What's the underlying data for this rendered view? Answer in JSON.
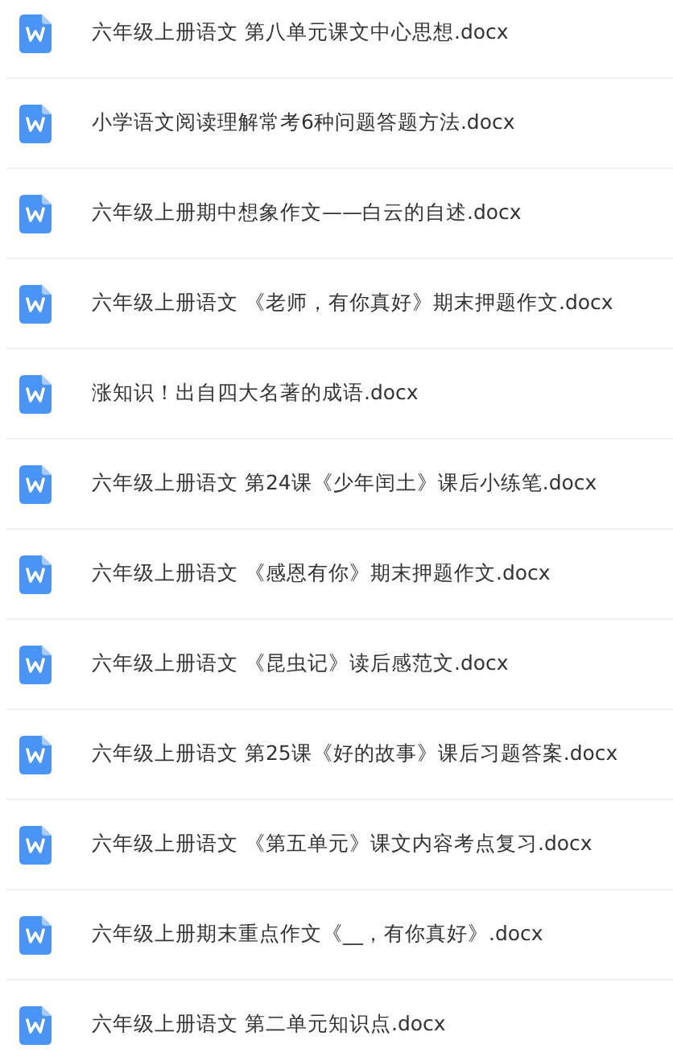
{
  "files": [
    {
      "name": "六年级上册语文 第八单元课文中心思想.docx"
    },
    {
      "name": "小学语文阅读理解常考6种问题答题方法.docx"
    },
    {
      "name": "六年级上册期中想象作文——白云的自述.docx"
    },
    {
      "name": "六年级上册语文 《老师，有你真好》期末押题作文.docx"
    },
    {
      "name": "涨知识！出自四大名著的成语.docx"
    },
    {
      "name": "六年级上册语文 第24课《少年闰土》课后小练笔.docx"
    },
    {
      "name": "六年级上册语文 《感恩有你》期末押题作文.docx"
    },
    {
      "name": "六年级上册语文 《昆虫记》读后感范文.docx"
    },
    {
      "name": "六年级上册语文 第25课《好的故事》课后习题答案.docx"
    },
    {
      "name": "六年级上册语文 《第五单元》课文内容考点复习.docx"
    },
    {
      "name": "六年级上册期末重点作文《__，有你真好》.docx"
    },
    {
      "name": "六年级上册语文 第二单元知识点.docx"
    }
  ]
}
